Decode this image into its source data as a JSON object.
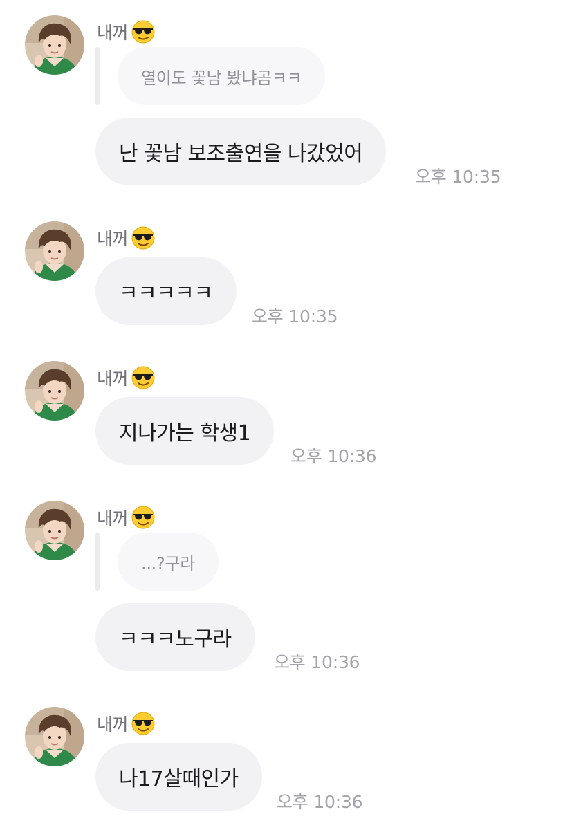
{
  "messages": [
    {
      "sender": "내꺼",
      "sender_emoji": "smiling-face-with-sunglasses",
      "reply": "열이도 꽃남 봤냐곰ㅋㅋ",
      "text": "난 꽃남 보조출연을 나갔었어",
      "time": "오후 10:35"
    },
    {
      "sender": "내꺼",
      "sender_emoji": "smiling-face-with-sunglasses",
      "text": "ㅋㅋㅋㅋㅋ",
      "time": "오후 10:35"
    },
    {
      "sender": "내꺼",
      "sender_emoji": "smiling-face-with-sunglasses",
      "text": "지나가는 학생1",
      "time": "오후 10:36"
    },
    {
      "sender": "내꺼",
      "sender_emoji": "smiling-face-with-sunglasses",
      "reply": "...?구라",
      "text": "ㅋㅋㅋ노구라",
      "time": "오후 10:36"
    },
    {
      "sender": "내꺼",
      "sender_emoji": "smiling-face-with-sunglasses",
      "text": "나17살때인가",
      "time": "오후 10:36"
    }
  ],
  "colors": {
    "bubble": "#f2f2f5",
    "reply_bubble": "#f7f7f9",
    "text": "#1b1b1e",
    "timestamp": "#a3a3aa",
    "sender": "#707077"
  }
}
